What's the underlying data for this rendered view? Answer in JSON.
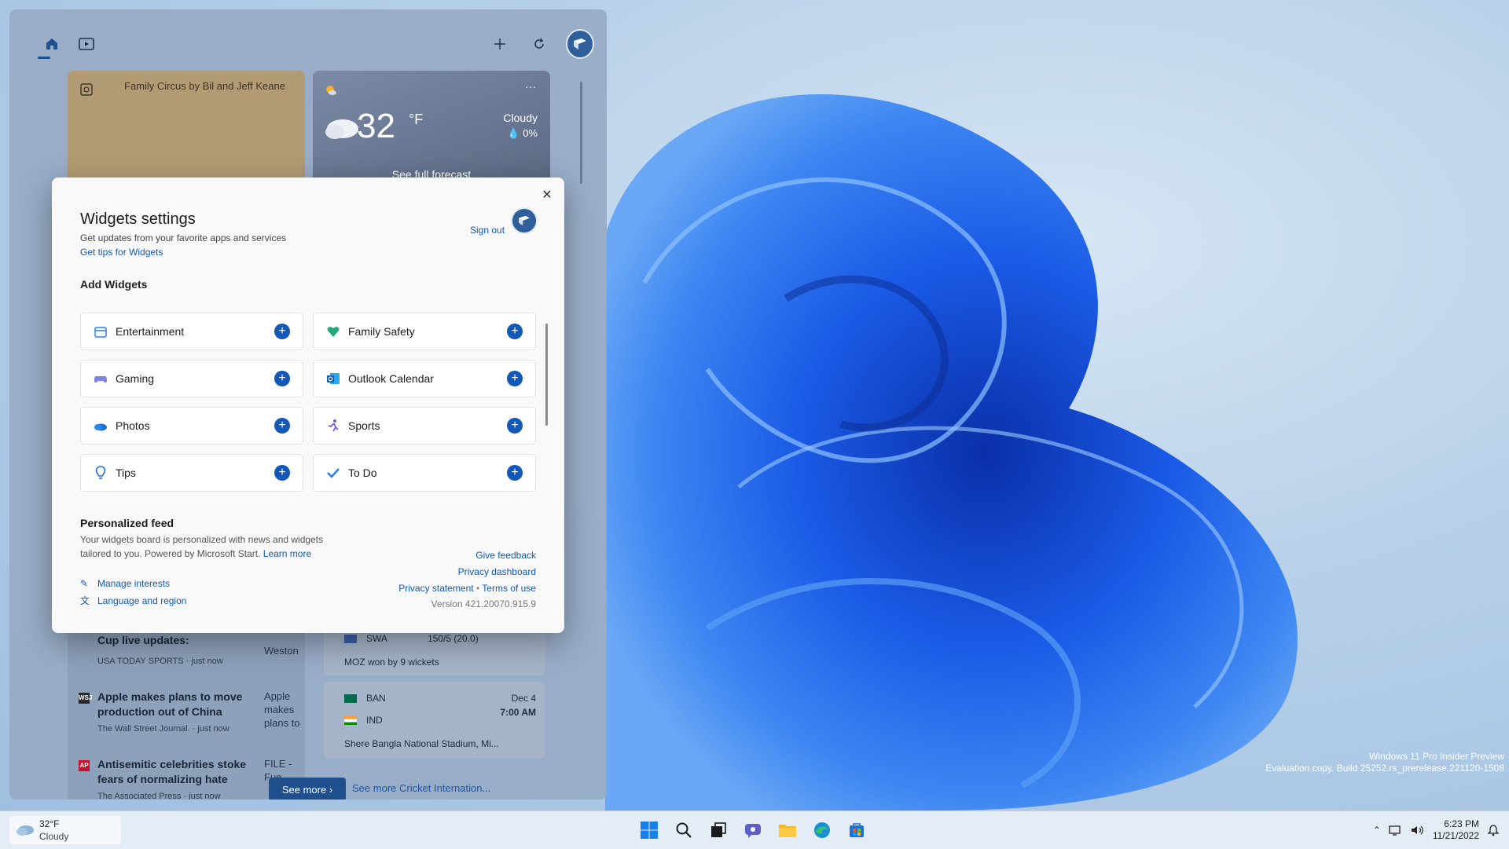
{
  "desktop": {
    "watermark_line1": "Windows 11 Pro Insider Preview",
    "watermark_line2": "Evaluation copy. Build 25252.rs_prerelease.221120-1508"
  },
  "board": {
    "comic_alt": "Family Circus by Bil and Jeff Keane",
    "weather": {
      "temp": "32",
      "unit": "°F",
      "condition": "Cloudy",
      "precip": "0%",
      "link": "See full forecast"
    },
    "news": [
      {
        "headline": "Cup live updates: American...",
        "meta": "USA TODAY SPORTS · just now",
        "thumb": "Weston"
      },
      {
        "headline": "Apple makes plans to move production out of China",
        "meta": "The Wall Street Journal. · just now",
        "thumb": "Apple makes plans to"
      },
      {
        "headline": "Antisemitic celebrities stoke fears of normalizing hate",
        "meta": "The Associated Press · just now",
        "thumb": "FILE - Fue..."
      }
    ],
    "cricket": {
      "match1": {
        "team": "SWA",
        "score": "150/5 (20.0)",
        "result": "MOZ won by 9 wickets"
      },
      "match2": {
        "team1": "BAN",
        "team2": "IND",
        "date": "Dec 4",
        "time": "7:00 AM",
        "venue": "Shere Bangla National Stadium, Mi..."
      }
    },
    "see_more_button": "See more",
    "see_more_link": "See more Cricket Internation..."
  },
  "dialog": {
    "title": "Widgets settings",
    "subtitle": "Get updates from your favorite apps and services",
    "tips_link": "Get tips for Widgets",
    "sign_out": "Sign out",
    "add_widgets_heading": "Add Widgets",
    "widgets": [
      {
        "label": "Entertainment",
        "icon": "entertainment-icon"
      },
      {
        "label": "Family Safety",
        "icon": "family-safety-icon"
      },
      {
        "label": "Gaming",
        "icon": "gaming-icon"
      },
      {
        "label": "Outlook Calendar",
        "icon": "outlook-calendar-icon"
      },
      {
        "label": "Photos",
        "icon": "photos-icon"
      },
      {
        "label": "Sports",
        "icon": "sports-icon"
      },
      {
        "label": "Tips",
        "icon": "tips-icon"
      },
      {
        "label": "To Do",
        "icon": "todo-icon"
      }
    ],
    "feed_heading": "Personalized feed",
    "feed_text": "Your widgets board is personalized with news and widgets tailored to you. Powered by Microsoft Start.",
    "learn_more": "Learn more",
    "manage_interests": "Manage interests",
    "language_region": "Language and region",
    "give_feedback": "Give feedback",
    "privacy_dashboard": "Privacy dashboard",
    "privacy_statement": "Privacy statement",
    "terms": "Terms of use",
    "version": "Version 421.20070.915.9"
  },
  "taskbar": {
    "weather_temp": "32°F",
    "weather_cond": "Cloudy",
    "time": "6:23 PM",
    "date": "11/21/2022"
  },
  "colors": {
    "accent": "#1158b7",
    "board": "#97aac4",
    "wallpaper_bloom": "#1a56e0"
  }
}
